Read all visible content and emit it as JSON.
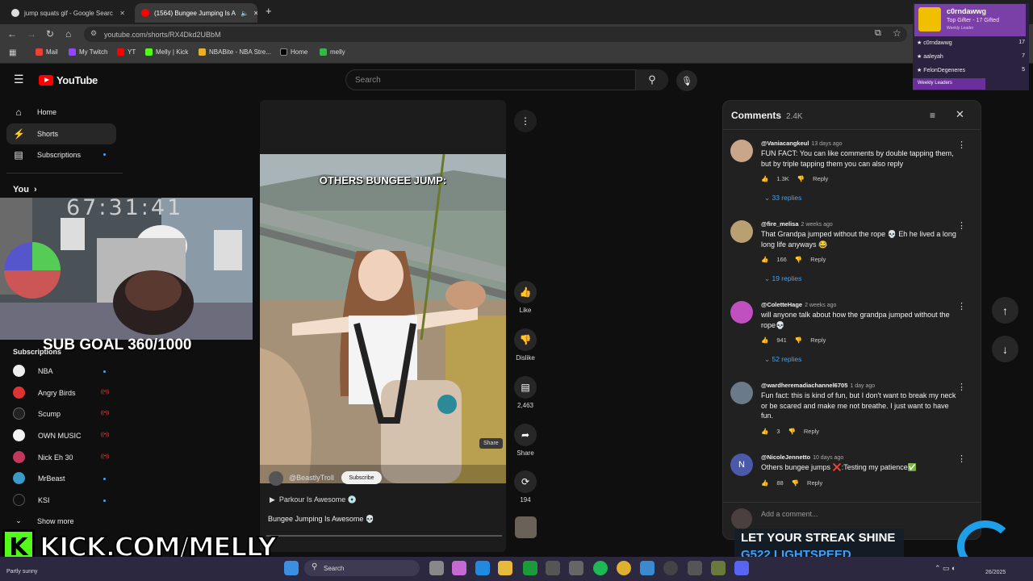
{
  "browser": {
    "tabs": [
      {
        "title": "jump squats gif - Google Searc",
        "active": false
      },
      {
        "title": "(1564) Bungee Jumping Is A",
        "active": true
      }
    ],
    "url": "youtube.com/shorts/RX4Dkd2UBbM",
    "bookmarks": [
      "Mail",
      "My Twitch",
      "YT",
      "Melly | Kick",
      "NBABite - NBA Stre...",
      "Home",
      "melly"
    ]
  },
  "youtube": {
    "logo": "YouTube",
    "search_placeholder": "Search",
    "nav": [
      "Home",
      "Shorts",
      "Subscriptions"
    ],
    "you_label": "You",
    "subscriptions_header": "Subscriptions",
    "subscriptions": [
      "NBA",
      "Angry Birds",
      "Scump",
      "OWN MUSIC",
      "Nick Eh 30",
      "MrBeast",
      "KSI"
    ],
    "show_more": "Show more"
  },
  "stream_overlay": {
    "timer": "67:31:41",
    "sub_goal": "SUB GOAL 360/1000",
    "kick_banner": "KICK.COM/MELLY",
    "logitech_line1": "LET YOUR STREAK SHINE",
    "logitech_line2": "G522 LIGHTSPEED",
    "leaderboard": {
      "top_name": "c0rndawwg",
      "top_title": "Top Gifter - 17 Gifted",
      "top_sub": "Weekly Leader",
      "rows": [
        {
          "name": "c0rndawwg",
          "count": "17"
        },
        {
          "name": "aaleyah",
          "count": "7"
        },
        {
          "name": "FelonDegeneres",
          "count": "5"
        }
      ],
      "footer": "Weekly Leaders"
    }
  },
  "short": {
    "overlay_title": "OTHERS BUNGEE JUMP:",
    "channel": "@BeastlyTroll",
    "subscribe": "Subscribe",
    "playlist": "Parkour Is Awesome 💿",
    "title": "Bungee Jumping Is Awesome 💀",
    "share_tooltip": "Share",
    "actions": {
      "like": "Like",
      "dislike": "Dislike",
      "comments": "2,463",
      "share": "Share",
      "remix": "194"
    }
  },
  "comments": {
    "title": "Comments",
    "count": "2.4K",
    "add_placeholder": "Add a comment...",
    "items": [
      {
        "user": "@Vaniacangkeul",
        "date": "13 days ago",
        "text": "FUN FACT: You can like comments by double tapping them, but by triple tapping them you can also reply",
        "likes": "1.3K",
        "replies": "33 replies",
        "avatar_color": "#c9a58a"
      },
      {
        "user": "@fire_melisa",
        "date": "2 weeks ago",
        "text": "That Grandpa jumped without the rope 💀 Eh he lived a long long life anyways 😂",
        "likes": "166",
        "replies": "19 replies",
        "avatar_color": "#b8a070"
      },
      {
        "user": "@ColetteHage",
        "date": "2 weeks ago",
        "text": "will anyone talk about how the grandpa jumped without the rope💀",
        "likes": "941",
        "replies": "52 replies",
        "avatar_color": "#c04fbf"
      },
      {
        "user": "@wardheremadiachannel6705",
        "date": "1 day ago",
        "text": "Fun fact: this is kind of fun, but I don't want to break my neck or be scared and make me not breathe. I just want to have fun.",
        "likes": "3",
        "replies": "",
        "avatar_color": "#6a7a8a"
      },
      {
        "user": "@NicoleJennetto",
        "date": "10 days ago",
        "text": "Others bungee jumps ❌:Testing my patience✅",
        "likes": "88",
        "replies": "",
        "avatar_color": "#4a5aa8"
      }
    ],
    "reply_label": "Reply"
  },
  "taskbar": {
    "weather": "Partly sunny",
    "search": "Search",
    "date": "26/2025"
  }
}
